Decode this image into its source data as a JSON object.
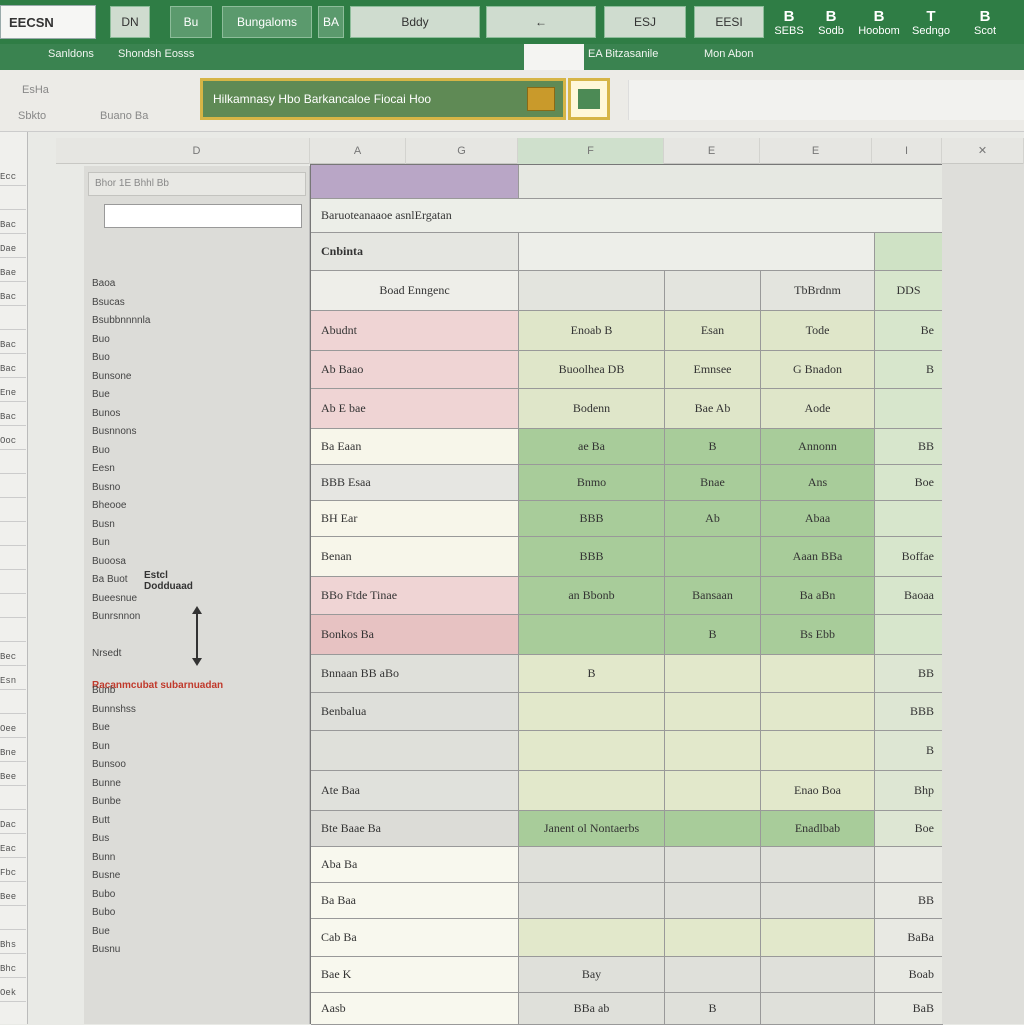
{
  "topbar": {
    "namebox": "EECSN",
    "tools": [
      "DN",
      "Bu",
      "Bungaloms",
      "BA",
      "Bddy",
      "",
      "ESJ",
      "EESI"
    ],
    "ribbon_icons": [
      {
        "glyph": "B",
        "label": "SEBS"
      },
      {
        "glyph": "B",
        "label": "Sodb"
      },
      {
        "glyph": "B",
        "label": "Hoobom"
      },
      {
        "glyph": "T",
        "label": "Sedngo"
      },
      {
        "glyph": "B",
        "label": "Scot"
      }
    ]
  },
  "tabs": [
    "Sanldons",
    "Shondsh Eosss",
    "",
    "EA Bitzasanile",
    "Mon Abon"
  ],
  "ribbon": {
    "formula_text": "Hilkamnasy Hbo  Barkancaloe Fiocai Hoo",
    "left_labels": [
      "EsHa",
      "Sbkto",
      "Buano Ba"
    ]
  },
  "left_strip": [
    "Ecc",
    "",
    "Bac",
    "Dae",
    "Bae",
    "Bac",
    "",
    "Bac",
    "Bac",
    "Ene",
    "Bac",
    "Ooc",
    "",
    "",
    "",
    "",
    "",
    "",
    "",
    "",
    "Bec",
    "Esn",
    "",
    "Oee",
    "Bne",
    "Bee",
    "",
    "Dac",
    "Eac",
    "Fbc",
    "Bee",
    "",
    "Bhs",
    "Bhc",
    "Oek"
  ],
  "col_headers": [
    "D",
    "A",
    "G",
    "F",
    "E",
    "E",
    "I"
  ],
  "panel": {
    "tool_labels": "Bhor  1E  Bhhl  Bb",
    "items": [
      "Baoa",
      "Bsucas",
      "Bsubbnnnnla",
      "Buo",
      "Buo",
      "Bunsone",
      "Bue",
      "Bunos",
      "Busnnons",
      "Buo",
      "Eesn",
      "Busno",
      "Bheooe",
      "Busn",
      "Bun",
      "Buoosa",
      "Ba Buot",
      "Bueesnue",
      "Bunrsnnon",
      "",
      "Nrsedt",
      "",
      "Bunb",
      "Bunnshss",
      "Bue",
      "Bun",
      "Bunsoo",
      "Bunne",
      "Bunbe",
      "Butt",
      "Bus",
      "Bunn",
      "Busne",
      "Bubo",
      "Bubo",
      "Bue",
      "Busnu"
    ],
    "annotation_line1": "Estcl",
    "annotation_line2": "Dodduaad",
    "red_note": "Racanmcubat subarnuadan"
  },
  "grid": {
    "title_row": "Baruoteanaaoe asnlErgatan",
    "section_label": "Cnbinta",
    "header_row": [
      "Boad Enngenc",
      "",
      "",
      "TbBrdnm",
      "DDS"
    ],
    "rows": [
      [
        "Abudnt",
        "Enoab B",
        "Esan",
        "Tode",
        "Be"
      ],
      [
        "Ab Baao",
        "Buoolhea DB",
        "Emnsee",
        "G Bnadon",
        "B"
      ],
      [
        "Ab E bae",
        "Bodenn",
        "Bae Ab",
        "Aode",
        ""
      ],
      [
        "Ba Eaan",
        "ae Ba",
        "B",
        "Annonn",
        "BB"
      ],
      [
        "BBB Esaa",
        "Bnmo",
        "Bnae",
        "Ans",
        "Boe"
      ],
      [
        "BH Ear",
        "BBB",
        "Ab",
        "Abaa",
        ""
      ],
      [
        "Benan",
        "BBB",
        "",
        "Aaan BBa",
        "Boffae"
      ],
      [
        "BBo Ftde Tinae",
        "an Bbonb",
        "Bansaan",
        "Ba aBn",
        "Baoaa"
      ],
      [
        "Bonkos Ba",
        "",
        "B",
        "Bs Ebb",
        ""
      ],
      [
        "Bnnaan BB aBo",
        "B",
        "",
        "",
        "BB"
      ],
      [
        "Benbalua",
        "",
        "",
        "",
        "BBB"
      ],
      [
        "",
        "",
        "",
        "",
        "B"
      ],
      [
        "Ate Baa",
        "",
        "",
        "Enao Boa",
        "Bhp"
      ],
      [
        "Bte Baae Ba",
        "Janent ol Nontaerbs",
        "",
        "Enadlbab",
        "Boe"
      ],
      [
        "Aba Ba",
        "",
        "",
        "",
        ""
      ],
      [
        "Ba Baa",
        "",
        "",
        "",
        "BB"
      ],
      [
        "Cab Ba",
        "",
        "",
        "",
        "BaBa"
      ],
      [
        "Bae K",
        "Bay",
        "",
        "",
        "Boab"
      ],
      [
        "Aasb",
        "BBa ab",
        "B",
        "",
        "BaB"
      ]
    ]
  },
  "colors": {
    "title_bar": "#2f7d45",
    "accent_gold": "#d6b546",
    "cell_green": "#a8cc9a",
    "cell_pink": "#e8c9c9",
    "cell_purple": "#b9a6c6"
  }
}
